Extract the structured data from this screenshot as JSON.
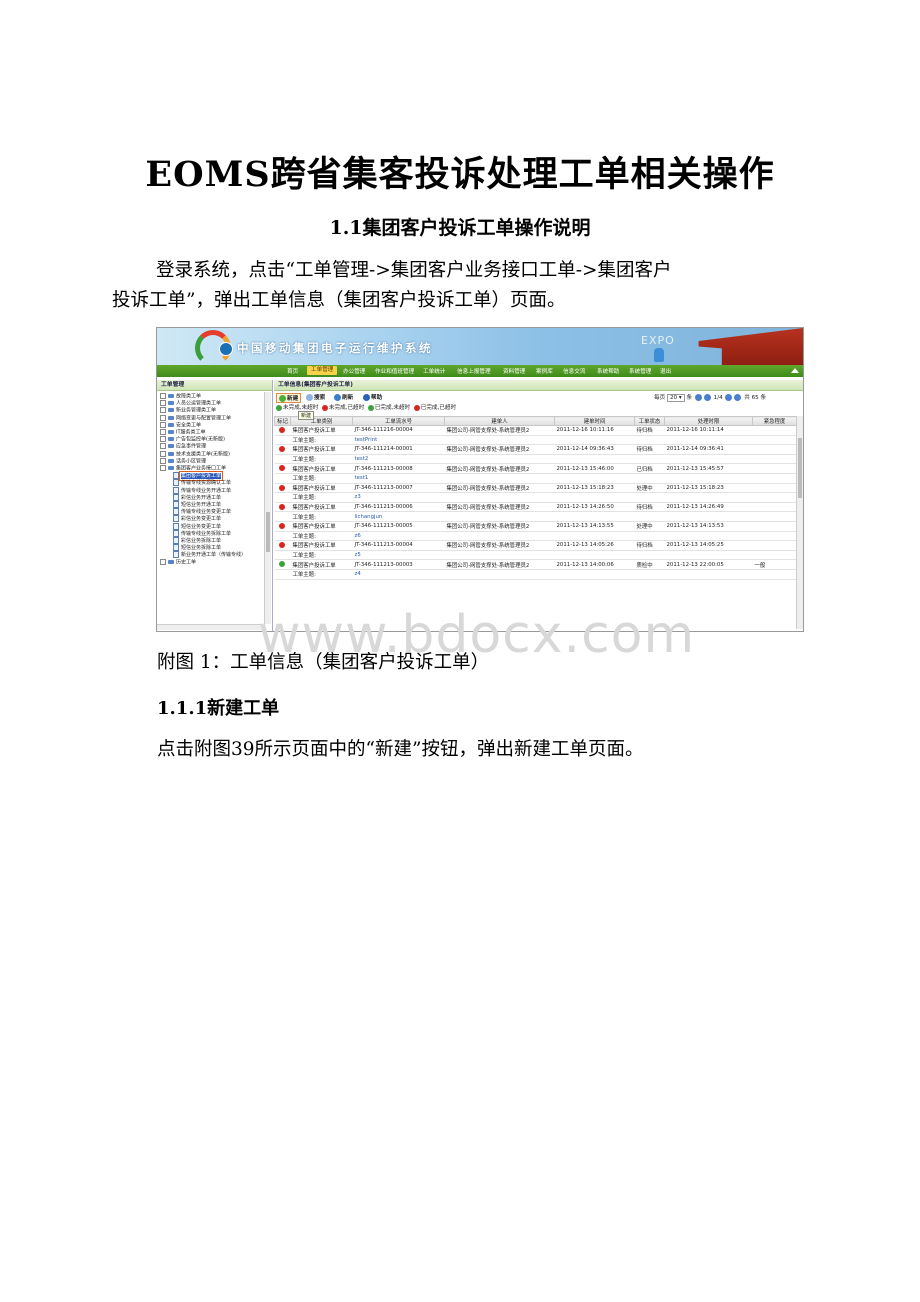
{
  "document": {
    "title": "EOMS跨省集客投诉处理工单相关操作",
    "section_1_1": "1.1集团客户投诉工单操作说明",
    "para_1_line1": "登录系统，点击“工单管理->集团客户业务接口工单->集团客户",
    "para_1_line2": "投诉工单”，弹出工单信息（集团客户投诉工单）页面。",
    "figure_caption": "附图 1：工单信息（集团客户投诉工单）",
    "section_1_1_1": "1.1.1新建工单",
    "para_2": "点击附图39所示页面中的“新建”按钮，弹出新建工单页面。",
    "watermark": "www.bdocx.com"
  },
  "screenshot": {
    "banner_title": "中国移动集团电子运行维护系统",
    "expo_text": "EXPO",
    "menu": [
      "首页",
      "工单管理",
      "办公管理",
      "作业和值班管理",
      "工单统计",
      "信息上报管理",
      "资料管理",
      "案例库",
      "信息交流",
      "系统帮助",
      "系统管理",
      "退出"
    ],
    "left_panel": {
      "title": "工单管理",
      "tree": [
        {
          "label": "故障类工单",
          "type": "folder"
        },
        {
          "label": "人员公运管理类工单",
          "type": "folder"
        },
        {
          "label": "新业务管理类工单",
          "type": "folder"
        },
        {
          "label": "网络变更与配置管理工单",
          "type": "folder"
        },
        {
          "label": "安全类工单",
          "type": "folder"
        },
        {
          "label": "IT服务类工单",
          "type": "folder"
        },
        {
          "label": "广告包监控单(无新版)",
          "type": "folder"
        },
        {
          "label": "应急事件管理",
          "type": "folder"
        },
        {
          "label": "技术支援类工单(无新版)",
          "type": "folder"
        },
        {
          "label": "话务小区管理",
          "type": "folder"
        },
        {
          "label": "集团客户业务接口工单",
          "type": "folder-open"
        },
        {
          "label": "集团客户投诉工单",
          "type": "doc",
          "selected": true
        },
        {
          "label": "传输专线资源确认工单",
          "type": "doc"
        },
        {
          "label": "传输专线业务开通工单",
          "type": "doc"
        },
        {
          "label": "彩信业务开通工单",
          "type": "doc"
        },
        {
          "label": "短信业务开通工单",
          "type": "doc"
        },
        {
          "label": "传输专线业务变更工单",
          "type": "doc"
        },
        {
          "label": "彩信业务变更工单",
          "type": "doc"
        },
        {
          "label": "短信业务变更工单",
          "type": "doc"
        },
        {
          "label": "传输专线业务拆除工单",
          "type": "doc"
        },
        {
          "label": "彩信业务拆除工单",
          "type": "doc"
        },
        {
          "label": "短信业务拆除工单",
          "type": "doc"
        },
        {
          "label": "新业务开通工单（传输专线）",
          "type": "doc"
        },
        {
          "label": "历史工单",
          "type": "folder"
        }
      ]
    },
    "right_panel": {
      "title": "工单信息(集团客户投诉工单)",
      "toolbar": {
        "new": "新建",
        "search": "搜索",
        "refresh": "刷新",
        "help": "帮助"
      },
      "tooltip": "新建",
      "pager": {
        "per_page_label": "每页",
        "per_page": "20",
        "unit": "条",
        "page": "1/4",
        "total": "共 65 条"
      },
      "legend": [
        "未完成,未超时",
        "未完成,已超时",
        "已完成,未超时",
        "已完成,已超时"
      ],
      "columns": [
        "标记",
        "工单类别",
        "工单流水号",
        "建单人",
        "建单时间",
        "工单状态",
        "处理时限",
        "紧急程度"
      ],
      "subject_label": "工单主题:",
      "rows": [
        {
          "status": "red",
          "type": "集团客户投诉工单",
          "sn": "JT-346-111216-00004",
          "creator": "集团公司-网管支撑处-系统管理员2",
          "created": "2011-12-16 10:11:16",
          "state": "待归档",
          "deadline": "2011-12-16 10:11:14",
          "urgency": "",
          "subject": "testPrint"
        },
        {
          "status": "red",
          "type": "集团客户投诉工单",
          "sn": "JT-346-111214-00001",
          "creator": "集团公司-网管支撑处-系统管理员2",
          "created": "2011-12-14 09:36:43",
          "state": "待归档",
          "deadline": "2011-12-14 09:36:41",
          "urgency": "",
          "subject": "test2"
        },
        {
          "status": "red",
          "type": "集团客户投诉工单",
          "sn": "JT-346-111213-00008",
          "creator": "集团公司-网管支撑处-系统管理员2",
          "created": "2011-12-13 15:46:00",
          "state": "已归档",
          "deadline": "2011-12-13 15:45:57",
          "urgency": "",
          "subject": "test1"
        },
        {
          "status": "red-bar",
          "type": "集团客户投诉工单",
          "sn": "JT-346-111213-00007",
          "creator": "集团公司-网管支撑处-系统管理员2",
          "created": "2011-12-13 15:18:23",
          "state": "处理中",
          "deadline": "2011-12-13 15:18:23",
          "urgency": "",
          "subject": "z3"
        },
        {
          "status": "red",
          "type": "集团客户投诉工单",
          "sn": "JT-346-111213-00006",
          "creator": "集团公司-网管支撑处-系统管理员2",
          "created": "2011-12-13 14:26:50",
          "state": "待归档",
          "deadline": "2011-12-13 14:26:49",
          "urgency": "",
          "subject": "lichangjun"
        },
        {
          "status": "red-bar",
          "type": "集团客户投诉工单",
          "sn": "JT-346-111213-00005",
          "creator": "集团公司-网管支撑处-系统管理员2",
          "created": "2011-12-13 14:13:55",
          "state": "处理中",
          "deadline": "2011-12-13 14:13:53",
          "urgency": "",
          "subject": "z6"
        },
        {
          "status": "red",
          "type": "集团客户投诉工单",
          "sn": "JT-346-111213-00004",
          "creator": "集团公司-网管支撑处-系统管理员2",
          "created": "2011-12-13 14:05:26",
          "state": "待归档",
          "deadline": "2011-12-13 14:05:25",
          "urgency": "",
          "subject": "z5"
        },
        {
          "status": "green",
          "type": "集团客户投诉工单",
          "sn": "JT-346-111213-00003",
          "creator": "集团公司-网管支撑处-系统管理员2",
          "created": "2011-12-13 14:00:06",
          "state": "质检中",
          "deadline": "2011-12-13 22:00:05",
          "urgency": "一般",
          "subject": "z4"
        }
      ]
    }
  }
}
